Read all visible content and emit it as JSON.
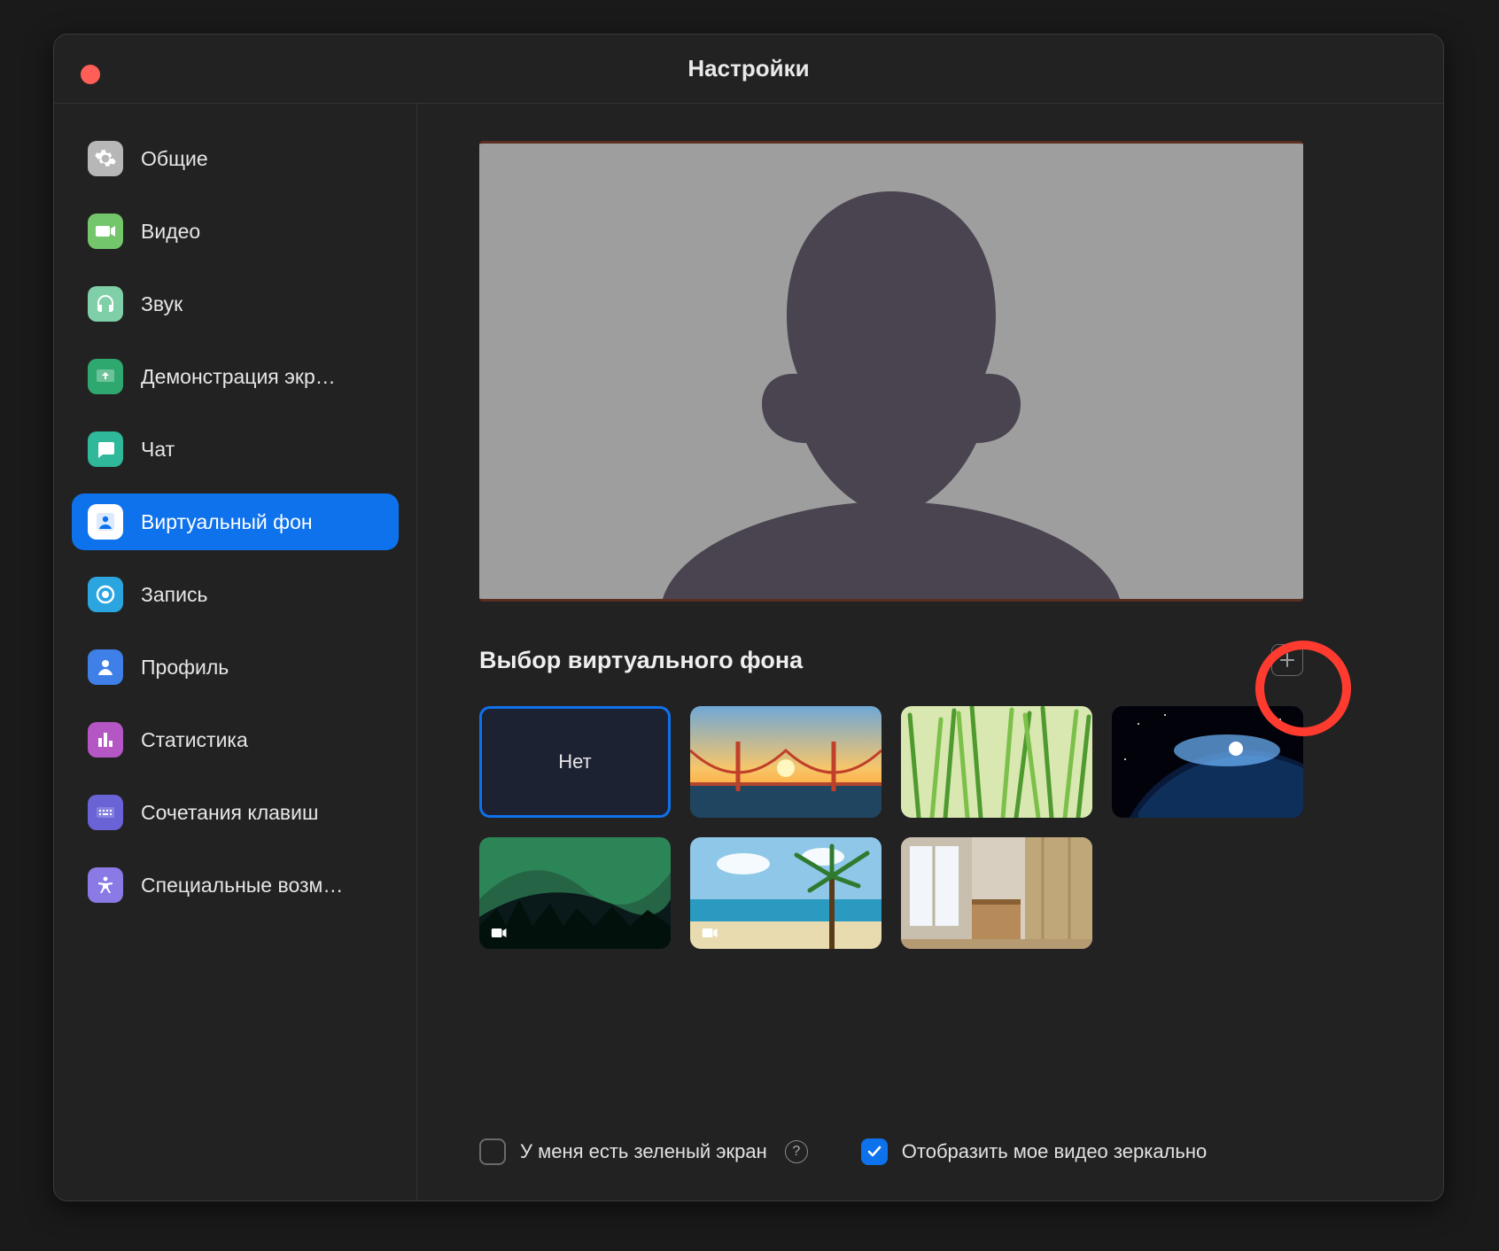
{
  "window": {
    "title": "Настройки"
  },
  "sidebar": {
    "items": [
      {
        "id": "general",
        "label": "Общие",
        "icon": "gear-icon",
        "bg": "#b7b7b7",
        "fg": "#ffffff"
      },
      {
        "id": "video",
        "label": "Видео",
        "icon": "video-icon",
        "bg": "#74c66b",
        "fg": "#ffffff"
      },
      {
        "id": "audio",
        "label": "Звук",
        "icon": "headphones-icon",
        "bg": "#7fd0a8",
        "fg": "#ffffff"
      },
      {
        "id": "share",
        "label": "Демонстрация экр…",
        "icon": "share-screen-icon",
        "bg": "#2fa86f",
        "fg": "#ffffff"
      },
      {
        "id": "chat",
        "label": "Чат",
        "icon": "chat-icon",
        "bg": "#2fb89a",
        "fg": "#ffffff"
      },
      {
        "id": "vbg",
        "label": "Виртуальный фон",
        "icon": "person-square-icon",
        "bg": "#ffffff",
        "fg": "#0e72ed",
        "active": true
      },
      {
        "id": "record",
        "label": "Запись",
        "icon": "record-icon",
        "bg": "#2aa5e0",
        "fg": "#ffffff"
      },
      {
        "id": "profile",
        "label": "Профиль",
        "icon": "person-icon",
        "bg": "#3f7fe8",
        "fg": "#ffffff"
      },
      {
        "id": "stats",
        "label": "Статистика",
        "icon": "bar-chart-icon",
        "bg": "#b456c4",
        "fg": "#ffffff"
      },
      {
        "id": "shortcuts",
        "label": "Сочетания клавиш",
        "icon": "keyboard-icon",
        "bg": "#6a63d6",
        "fg": "#ffffff"
      },
      {
        "id": "accessibility",
        "label": "Специальные возм…",
        "icon": "accessibility-icon",
        "bg": "#8a7ae6",
        "fg": "#ffffff"
      }
    ]
  },
  "main": {
    "section_title": "Выбор виртуального фона",
    "add_button_title": "Добавить изображение",
    "backgrounds": [
      {
        "id": "none",
        "label": "Нет",
        "kind": "none",
        "selected": true
      },
      {
        "id": "bridge",
        "label": "Golden Gate",
        "kind": "image"
      },
      {
        "id": "grass",
        "label": "Grass",
        "kind": "image"
      },
      {
        "id": "earth",
        "label": "Earth",
        "kind": "image"
      },
      {
        "id": "aurora",
        "label": "Aurora",
        "kind": "video"
      },
      {
        "id": "beach",
        "label": "Beach",
        "kind": "video"
      },
      {
        "id": "room",
        "label": "Room",
        "kind": "image"
      }
    ],
    "greenscreen_label": "У меня есть зеленый экран",
    "greenscreen_checked": false,
    "mirror_label": "Отобразить мое видео зеркально",
    "mirror_checked": true
  },
  "annotation": {
    "highlight_add_button": true
  }
}
